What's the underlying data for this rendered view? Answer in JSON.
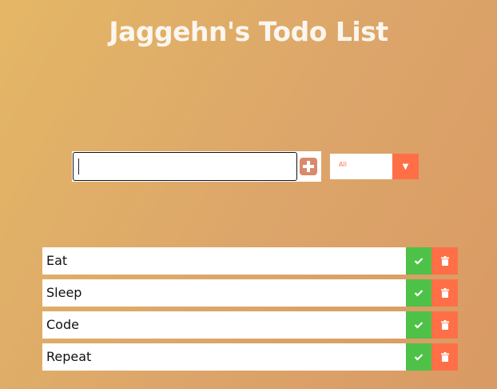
{
  "app": {
    "title": "Jaggehn's Todo List"
  },
  "form": {
    "input_value": "",
    "add_icon": "plus-square-icon",
    "filter_selected": "All",
    "filter_arrow_icon": "caret-down-icon"
  },
  "todos": [
    {
      "text": "Eat"
    },
    {
      "text": "Sleep"
    },
    {
      "text": "Code"
    },
    {
      "text": "Repeat"
    }
  ],
  "icons": {
    "complete": "check-icon",
    "delete": "trash-icon"
  },
  "colors": {
    "background_start": "#e4b766",
    "background_end": "#d99a63",
    "accent": "#ff6f47",
    "complete": "#4ec148",
    "add_button": "#d98a6a",
    "title": "#fbf6ee"
  }
}
